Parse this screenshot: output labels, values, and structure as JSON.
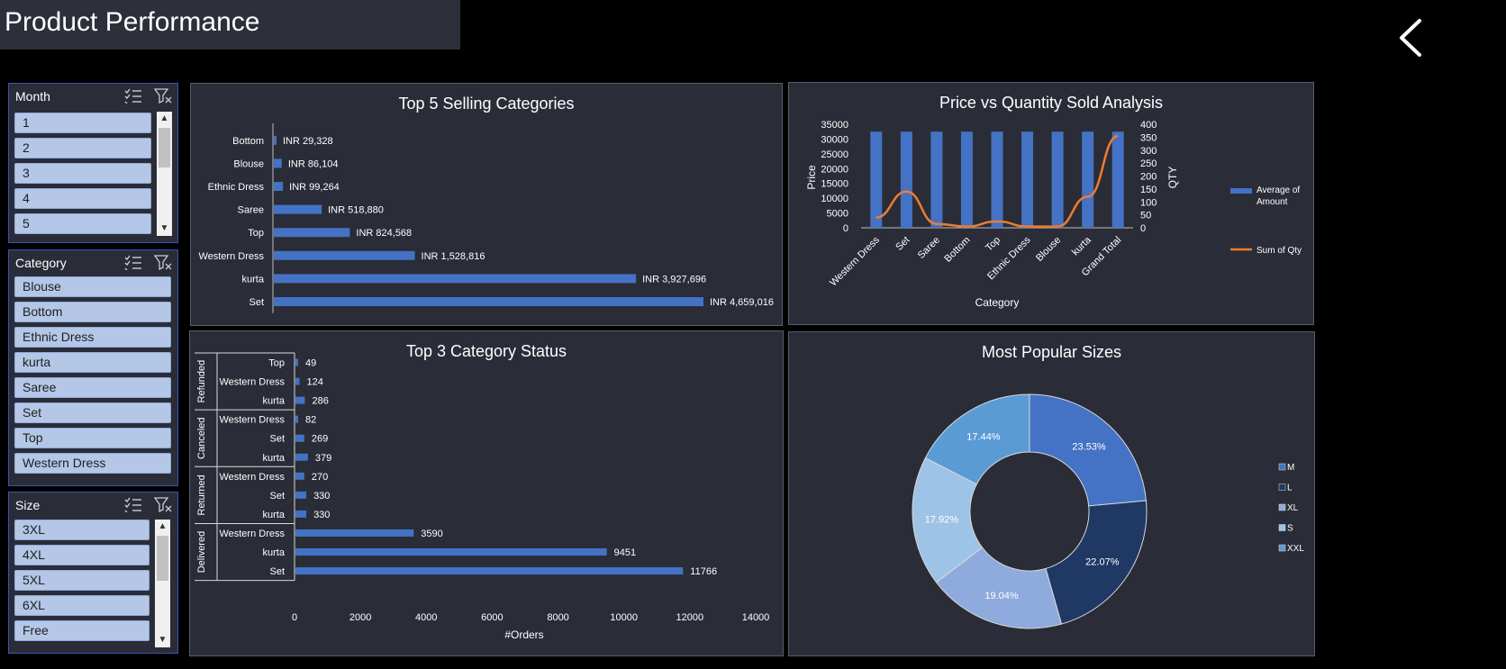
{
  "page": {
    "title": "Product Performance"
  },
  "slicers": {
    "month": {
      "title": "Month",
      "items": [
        "1",
        "2",
        "3",
        "4",
        "5"
      ]
    },
    "category": {
      "title": "Category",
      "items": [
        "Blouse",
        "Bottom",
        "Ethnic Dress",
        "kurta",
        "Saree",
        "Set",
        "Top",
        "Western Dress"
      ]
    },
    "size": {
      "title": "Size",
      "items": [
        "3XL",
        "4XL",
        "5XL",
        "6XL",
        "Free"
      ]
    }
  },
  "chart_data": [
    {
      "type": "bar",
      "title": "Top 5 Selling Categories",
      "orientation": "horizontal",
      "categories": [
        "Bottom",
        "Blouse",
        "Ethnic Dress",
        "Saree",
        "Top",
        "Western Dress",
        "kurta",
        "Set"
      ],
      "values": [
        29328,
        86104,
        99264,
        518880,
        824568,
        1528816,
        3927696,
        4659016
      ],
      "labels": [
        "INR 29,328",
        "INR 86,104",
        "INR 99,264",
        "INR 518,880",
        "INR 824,568",
        "INR 1,528,816",
        "INR 3,927,696",
        "INR 4,659,016"
      ],
      "color": "#4472c4"
    },
    {
      "type": "bar",
      "title": "Price vs Quantity Sold Analysis",
      "categories": [
        "Western Dress",
        "Set",
        "Saree",
        "Bottom",
        "Top",
        "Ethnic Dress",
        "Blouse",
        "kurta",
        "Grand Total"
      ],
      "xlabel": "Category",
      "ylabel": "Price",
      "y2label": "QTY",
      "yticks": [
        "35000",
        "30000",
        "25000",
        "20000",
        "15000",
        "10000",
        "5000",
        "0"
      ],
      "y2ticks": [
        "400",
        "350",
        "300",
        "250",
        "200",
        "150",
        "100",
        "50",
        "0"
      ],
      "ylim": [
        0,
        35000
      ],
      "y2lim": [
        0,
        400
      ],
      "series": [
        {
          "name": "Average of Amount",
          "type": "bar",
          "color": "#4472c4",
          "values": [
            32500,
            32500,
            32500,
            32500,
            32500,
            32500,
            32500,
            32500,
            32500
          ]
        },
        {
          "name": "Sum of Qty",
          "type": "line",
          "color": "#ed7d31",
          "values": [
            40,
            140,
            15,
            5,
            25,
            5,
            5,
            120,
            355
          ]
        }
      ]
    },
    {
      "type": "bar",
      "title": "Top 3 Category Status",
      "orientation": "horizontal",
      "xlabel": "#Orders",
      "xticks": [
        "0",
        "2000",
        "4000",
        "6000",
        "8000",
        "10000",
        "12000",
        "14000"
      ],
      "xlim": [
        0,
        14000
      ],
      "color": "#4472c4",
      "groups": [
        {
          "name": "Refunded",
          "rows": [
            {
              "label": "Top",
              "value": 49,
              "value_label": "49"
            },
            {
              "label": "Western Dress",
              "value": 124,
              "value_label": "124"
            },
            {
              "label": "kurta",
              "value": 286,
              "value_label": "286"
            }
          ]
        },
        {
          "name": "Canceled",
          "rows": [
            {
              "label": "Western Dress",
              "value": 82,
              "value_label": "82"
            },
            {
              "label": "Set",
              "value": 269,
              "value_label": "269"
            },
            {
              "label": "kurta",
              "value": 379,
              "value_label": "379"
            }
          ]
        },
        {
          "name": "Returned",
          "rows": [
            {
              "label": "Western Dress",
              "value": 270,
              "value_label": "270"
            },
            {
              "label": "Set",
              "value": 330,
              "value_label": "330"
            },
            {
              "label": "kurta",
              "value": 330,
              "value_label": "330"
            }
          ]
        },
        {
          "name": "Delivered",
          "rows": [
            {
              "label": "Western Dress",
              "value": 3590,
              "value_label": "3590"
            },
            {
              "label": "kurta",
              "value": 9451,
              "value_label": "9451"
            },
            {
              "label": "Set",
              "value": 11766,
              "value_label": "11766"
            }
          ]
        }
      ]
    },
    {
      "type": "pie",
      "variant": "donut",
      "title": "Most Popular Sizes",
      "slices": [
        {
          "name": "M",
          "value": 23.53,
          "label": "23.53%",
          "color": "#4472c4"
        },
        {
          "name": "L",
          "value": 22.07,
          "label": "22.07%",
          "color": "#1f3864"
        },
        {
          "name": "XL",
          "value": 19.04,
          "label": "19.04%",
          "color": "#8faadc"
        },
        {
          "name": "S",
          "value": 17.92,
          "label": "17.92%",
          "color": "#9dc3e6"
        },
        {
          "name": "XXL",
          "value": 17.44,
          "label": "17.44%",
          "color": "#5b9bd5"
        }
      ]
    }
  ]
}
